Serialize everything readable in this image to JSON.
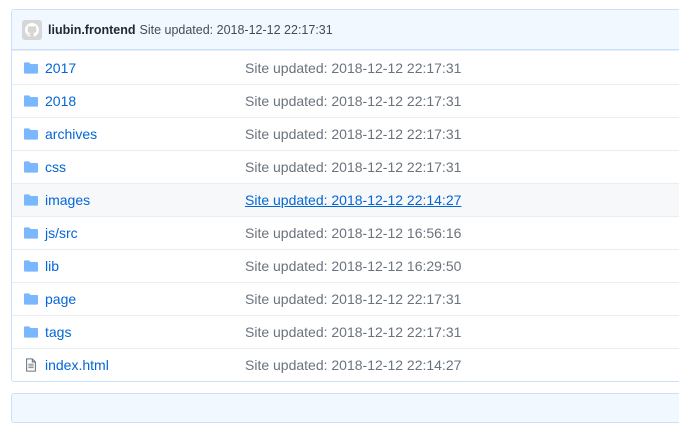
{
  "commit": {
    "author": "liubin.frontend",
    "message": "Site updated: 2018-12-12 22:17:31"
  },
  "files": [
    {
      "name": "2017",
      "type": "folder",
      "message": "Site updated: 2018-12-12 22:17:31"
    },
    {
      "name": "2018",
      "type": "folder",
      "message": "Site updated: 2018-12-12 22:17:31"
    },
    {
      "name": "archives",
      "type": "folder",
      "message": "Site updated: 2018-12-12 22:17:31"
    },
    {
      "name": "css",
      "type": "folder",
      "message": "Site updated: 2018-12-12 22:17:31"
    },
    {
      "name": "images",
      "type": "folder",
      "message": "Site updated: 2018-12-12 22:14:27"
    },
    {
      "name": "js/src",
      "type": "folder",
      "message": "Site updated: 2018-12-12 16:56:16"
    },
    {
      "name": "lib",
      "type": "folder",
      "message": "Site updated: 2018-12-12 16:29:50"
    },
    {
      "name": "page",
      "type": "folder",
      "message": "Site updated: 2018-12-12 22:17:31"
    },
    {
      "name": "tags",
      "type": "folder",
      "message": "Site updated: 2018-12-12 22:17:31"
    },
    {
      "name": "index.html",
      "type": "file",
      "message": "Site updated: 2018-12-12 22:14:27"
    }
  ],
  "colors": {
    "link": "#0366d6",
    "muted": "#6a737d",
    "folder": "#79b8ff",
    "header_bg": "#f1f8ff"
  }
}
